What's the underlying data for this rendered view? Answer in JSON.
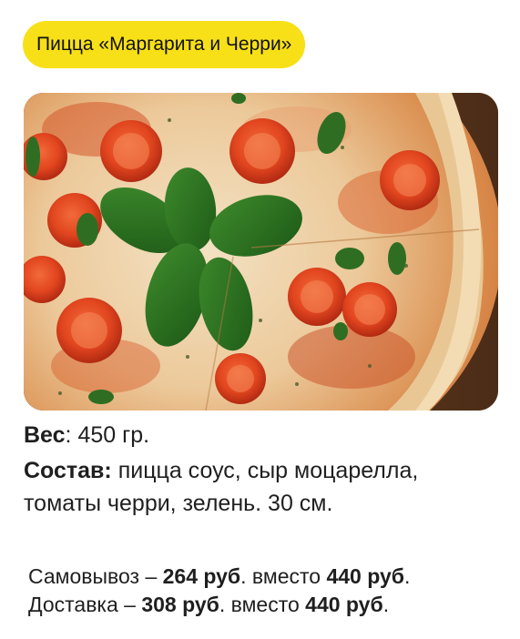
{
  "product": {
    "title": "Пицца «Маргарита и Черри»",
    "accent_color": "#f7e017"
  },
  "image": {
    "alt": "pizza-margherita-cherry-photo"
  },
  "details": {
    "weight_label": "Вес",
    "weight_sep": ":",
    "weight_value": " 450 гр.",
    "composition_label": "Состав:",
    "composition_line1": " пицца соус, сыр моцарелла,",
    "composition_line2": "томаты черри, зелень. 30 см."
  },
  "pricing": {
    "pickup_label": "Самовывоз – ",
    "pickup_price": "264 руб",
    "pickup_mid": ". вместо ",
    "pickup_old": "440 руб",
    "pickup_end": ".",
    "delivery_label": "Доставка – ",
    "delivery_price": "308 руб",
    "delivery_mid": ". вместо ",
    "delivery_old": "440 руб",
    "delivery_end": "."
  }
}
